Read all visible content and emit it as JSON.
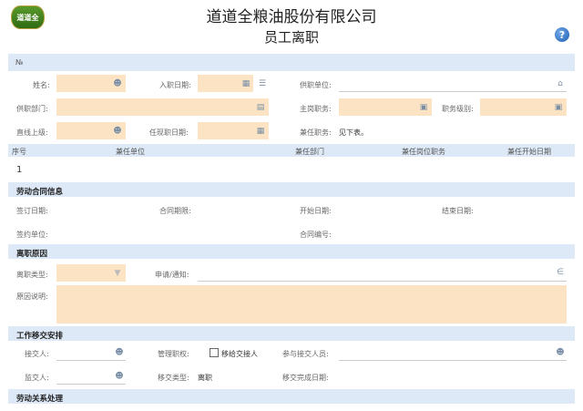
{
  "header": {
    "logo_text": "道道全",
    "company": "道道全粮油股份有限公司",
    "form_title": "员工离职"
  },
  "basic": {
    "no_label": "№",
    "name_label": "姓名:",
    "entry_date_label": "入职日期:",
    "unit_label": "供职单位:",
    "dept_label": "供职部门:",
    "main_post_label": "主岗职务:",
    "level_label": "职务级别:",
    "superior_label": "直线上级:",
    "post_date_label": "任现职日期:",
    "concurrent_label": "兼任职务:",
    "concurrent_value": "见下表。"
  },
  "concurrent_table": {
    "headers": [
      "序号",
      "兼任单位",
      "兼任部门",
      "兼任岗位职务",
      "兼任开始日期"
    ],
    "rows": [
      [
        "1",
        "",
        "",
        "",
        ""
      ]
    ]
  },
  "contract": {
    "title": "劳动合同信息",
    "sign_date_label": "签订日期:",
    "term_label": "合同期限:",
    "start_date_label": "开始日期:",
    "end_date_label": "结束日期:",
    "sign_unit_label": "签约单位:",
    "contract_no_label": "合同编号:"
  },
  "resign": {
    "title": "离职原因",
    "type_label": "离职类型:",
    "notice_label": "申请/通知:",
    "reason_label": "原因说明:"
  },
  "handover": {
    "title": "工作移交安排",
    "receiver_label": "接交人:",
    "admin_label": "管理职权:",
    "admin_checkbox_label": "移给交接人",
    "participants_label": "参与接交人员:",
    "supervisor_label": "监交人:",
    "type_label": "移交类型:",
    "type_value": "离职",
    "finish_date_label": "移交完成日期:"
  },
  "labor": {
    "title": "劳动关系处理"
  },
  "colors": {
    "band": "#dde9f7",
    "input_fill": "#fbe3c3"
  }
}
